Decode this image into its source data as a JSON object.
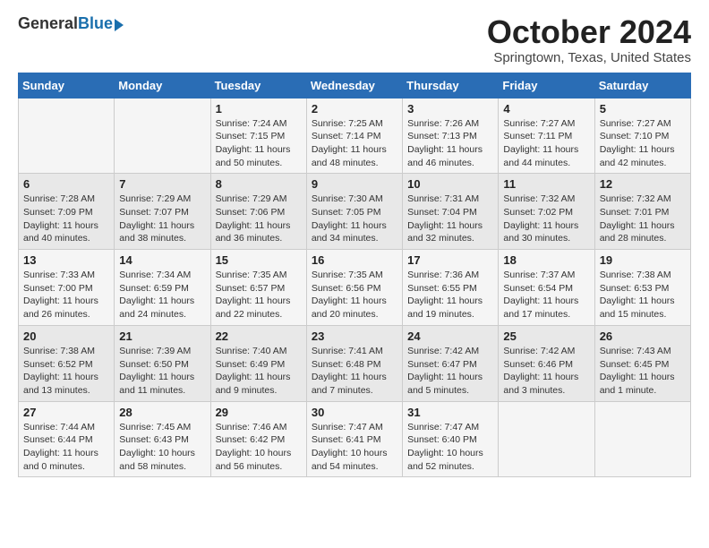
{
  "header": {
    "logo_general": "General",
    "logo_blue": "Blue",
    "month_title": "October 2024",
    "location": "Springtown, Texas, United States"
  },
  "days_of_week": [
    "Sunday",
    "Monday",
    "Tuesday",
    "Wednesday",
    "Thursday",
    "Friday",
    "Saturday"
  ],
  "weeks": [
    [
      {
        "day": "",
        "sunrise": "",
        "sunset": "",
        "daylight": ""
      },
      {
        "day": "",
        "sunrise": "",
        "sunset": "",
        "daylight": ""
      },
      {
        "day": "1",
        "sunrise": "Sunrise: 7:24 AM",
        "sunset": "Sunset: 7:15 PM",
        "daylight": "Daylight: 11 hours and 50 minutes."
      },
      {
        "day": "2",
        "sunrise": "Sunrise: 7:25 AM",
        "sunset": "Sunset: 7:14 PM",
        "daylight": "Daylight: 11 hours and 48 minutes."
      },
      {
        "day": "3",
        "sunrise": "Sunrise: 7:26 AM",
        "sunset": "Sunset: 7:13 PM",
        "daylight": "Daylight: 11 hours and 46 minutes."
      },
      {
        "day": "4",
        "sunrise": "Sunrise: 7:27 AM",
        "sunset": "Sunset: 7:11 PM",
        "daylight": "Daylight: 11 hours and 44 minutes."
      },
      {
        "day": "5",
        "sunrise": "Sunrise: 7:27 AM",
        "sunset": "Sunset: 7:10 PM",
        "daylight": "Daylight: 11 hours and 42 minutes."
      }
    ],
    [
      {
        "day": "6",
        "sunrise": "Sunrise: 7:28 AM",
        "sunset": "Sunset: 7:09 PM",
        "daylight": "Daylight: 11 hours and 40 minutes."
      },
      {
        "day": "7",
        "sunrise": "Sunrise: 7:29 AM",
        "sunset": "Sunset: 7:07 PM",
        "daylight": "Daylight: 11 hours and 38 minutes."
      },
      {
        "day": "8",
        "sunrise": "Sunrise: 7:29 AM",
        "sunset": "Sunset: 7:06 PM",
        "daylight": "Daylight: 11 hours and 36 minutes."
      },
      {
        "day": "9",
        "sunrise": "Sunrise: 7:30 AM",
        "sunset": "Sunset: 7:05 PM",
        "daylight": "Daylight: 11 hours and 34 minutes."
      },
      {
        "day": "10",
        "sunrise": "Sunrise: 7:31 AM",
        "sunset": "Sunset: 7:04 PM",
        "daylight": "Daylight: 11 hours and 32 minutes."
      },
      {
        "day": "11",
        "sunrise": "Sunrise: 7:32 AM",
        "sunset": "Sunset: 7:02 PM",
        "daylight": "Daylight: 11 hours and 30 minutes."
      },
      {
        "day": "12",
        "sunrise": "Sunrise: 7:32 AM",
        "sunset": "Sunset: 7:01 PM",
        "daylight": "Daylight: 11 hours and 28 minutes."
      }
    ],
    [
      {
        "day": "13",
        "sunrise": "Sunrise: 7:33 AM",
        "sunset": "Sunset: 7:00 PM",
        "daylight": "Daylight: 11 hours and 26 minutes."
      },
      {
        "day": "14",
        "sunrise": "Sunrise: 7:34 AM",
        "sunset": "Sunset: 6:59 PM",
        "daylight": "Daylight: 11 hours and 24 minutes."
      },
      {
        "day": "15",
        "sunrise": "Sunrise: 7:35 AM",
        "sunset": "Sunset: 6:57 PM",
        "daylight": "Daylight: 11 hours and 22 minutes."
      },
      {
        "day": "16",
        "sunrise": "Sunrise: 7:35 AM",
        "sunset": "Sunset: 6:56 PM",
        "daylight": "Daylight: 11 hours and 20 minutes."
      },
      {
        "day": "17",
        "sunrise": "Sunrise: 7:36 AM",
        "sunset": "Sunset: 6:55 PM",
        "daylight": "Daylight: 11 hours and 19 minutes."
      },
      {
        "day": "18",
        "sunrise": "Sunrise: 7:37 AM",
        "sunset": "Sunset: 6:54 PM",
        "daylight": "Daylight: 11 hours and 17 minutes."
      },
      {
        "day": "19",
        "sunrise": "Sunrise: 7:38 AM",
        "sunset": "Sunset: 6:53 PM",
        "daylight": "Daylight: 11 hours and 15 minutes."
      }
    ],
    [
      {
        "day": "20",
        "sunrise": "Sunrise: 7:38 AM",
        "sunset": "Sunset: 6:52 PM",
        "daylight": "Daylight: 11 hours and 13 minutes."
      },
      {
        "day": "21",
        "sunrise": "Sunrise: 7:39 AM",
        "sunset": "Sunset: 6:50 PM",
        "daylight": "Daylight: 11 hours and 11 minutes."
      },
      {
        "day": "22",
        "sunrise": "Sunrise: 7:40 AM",
        "sunset": "Sunset: 6:49 PM",
        "daylight": "Daylight: 11 hours and 9 minutes."
      },
      {
        "day": "23",
        "sunrise": "Sunrise: 7:41 AM",
        "sunset": "Sunset: 6:48 PM",
        "daylight": "Daylight: 11 hours and 7 minutes."
      },
      {
        "day": "24",
        "sunrise": "Sunrise: 7:42 AM",
        "sunset": "Sunset: 6:47 PM",
        "daylight": "Daylight: 11 hours and 5 minutes."
      },
      {
        "day": "25",
        "sunrise": "Sunrise: 7:42 AM",
        "sunset": "Sunset: 6:46 PM",
        "daylight": "Daylight: 11 hours and 3 minutes."
      },
      {
        "day": "26",
        "sunrise": "Sunrise: 7:43 AM",
        "sunset": "Sunset: 6:45 PM",
        "daylight": "Daylight: 11 hours and 1 minute."
      }
    ],
    [
      {
        "day": "27",
        "sunrise": "Sunrise: 7:44 AM",
        "sunset": "Sunset: 6:44 PM",
        "daylight": "Daylight: 11 hours and 0 minutes."
      },
      {
        "day": "28",
        "sunrise": "Sunrise: 7:45 AM",
        "sunset": "Sunset: 6:43 PM",
        "daylight": "Daylight: 10 hours and 58 minutes."
      },
      {
        "day": "29",
        "sunrise": "Sunrise: 7:46 AM",
        "sunset": "Sunset: 6:42 PM",
        "daylight": "Daylight: 10 hours and 56 minutes."
      },
      {
        "day": "30",
        "sunrise": "Sunrise: 7:47 AM",
        "sunset": "Sunset: 6:41 PM",
        "daylight": "Daylight: 10 hours and 54 minutes."
      },
      {
        "day": "31",
        "sunrise": "Sunrise: 7:47 AM",
        "sunset": "Sunset: 6:40 PM",
        "daylight": "Daylight: 10 hours and 52 minutes."
      },
      {
        "day": "",
        "sunrise": "",
        "sunset": "",
        "daylight": ""
      },
      {
        "day": "",
        "sunrise": "",
        "sunset": "",
        "daylight": ""
      }
    ]
  ]
}
